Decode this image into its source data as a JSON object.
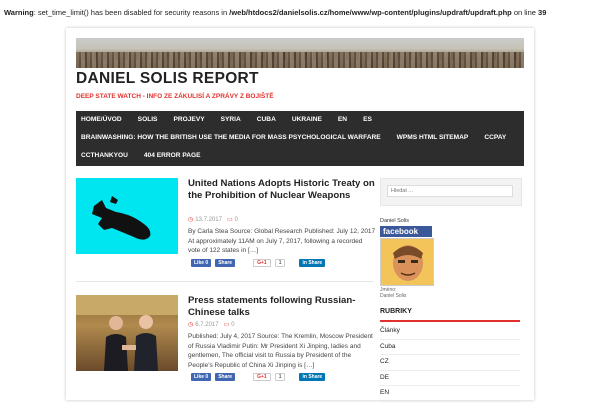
{
  "warning": {
    "label": "Warning",
    "message": ": set_time_limit() has been disabled for security reasons in ",
    "path": "/web/htdocs2/danielsolis.cz/home/www/wp-content/plugins/updraft/updraft.php",
    "online": " on line ",
    "line": "39"
  },
  "site": {
    "title": "DANIEL SOLIS REPORT",
    "tagline": "DEEP STATE WATCH - INFO ZE ZÁKULISÍ A ZPRÁVY Z BOJIŠTĚ"
  },
  "nav": {
    "row1": [
      "HOME/ÚVOD",
      "SOLIS",
      "PROJEVY",
      "SYRIA",
      "CUBA",
      "UKRAINE",
      "EN",
      "ES"
    ],
    "row2": [
      "BRAINWASHING: HOW THE BRITISH USE THE MEDIA FOR MASS PSYCHOLOGICAL WARFARE",
      "WPMS HTML SITEMAP",
      "CCPAY"
    ],
    "row3": [
      "CCTHANKYOU",
      "404 ERROR PAGE"
    ]
  },
  "posts": [
    {
      "title": "United Nations Adopts Historic Treaty on the Prohibition of Nuclear Weapons",
      "date": "13.7.2017",
      "comments": "0",
      "excerpt": "By Carla Stea Source: Global Research Published: July 12, 2017   At approximately 11AM on July 7, 2017, following a recorded vote of 122 states in […]"
    },
    {
      "title": "Press statements following Russian-Chinese talks",
      "date": "6.7.2017",
      "comments": "0",
      "excerpt": "Published: July 4, 2017 Source: The Kremlin, Moscow President of Russia Vladimir Putin: Mr President Xi Jinping, ladies and gentlemen, The official visit to Russia by President of the People's Republic of China Xi Jinping is […]"
    }
  ],
  "share": {
    "like": "Like 0",
    "share": "Share",
    "gplus": "G+1",
    "count": "1",
    "linkedin": "Share"
  },
  "sidebar": {
    "search_placeholder": "Hledat ...",
    "fb_author": "Daniel Solis",
    "fb_brand": "facebook",
    "fb_caption_1": "Jméno:",
    "fb_caption_2": "Daniel Solis",
    "rubriky_title": "RUBRIKY",
    "rubriky": [
      "Články",
      "Cuba",
      "CZ",
      "DE",
      "EN"
    ]
  },
  "colors": {
    "accent": "#e2312d",
    "nav_bg": "#2d2d2d",
    "thumb1_bg": "#00e6f0",
    "facebook": "#3b5998"
  }
}
